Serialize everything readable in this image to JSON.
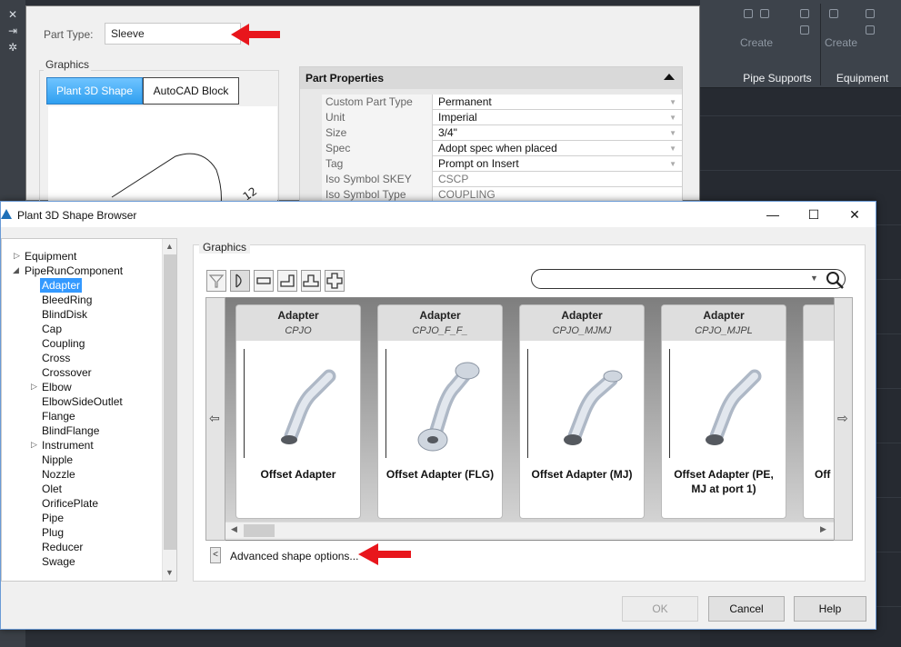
{
  "background": {
    "ribbon": {
      "panels": [
        {
          "label": "Pipe Supports",
          "create_label": "Create"
        },
        {
          "label": "Equipment",
          "create_label": "Create"
        }
      ]
    },
    "left_toolbar_glyphs": [
      "✕",
      "⇥",
      "✲"
    ]
  },
  "part_dialog": {
    "part_type_label": "Part Type:",
    "part_type_value": "Sleeve",
    "graphics_label": "Graphics",
    "tabs": [
      {
        "label": "Plant 3D Shape",
        "active": true
      },
      {
        "label": "AutoCAD Block",
        "active": false
      }
    ],
    "properties": {
      "header": "Part Properties",
      "rows": [
        {
          "name": "Custom Part Type",
          "value": "Permanent"
        },
        {
          "name": "Unit",
          "value": "Imperial"
        },
        {
          "name": "Size",
          "value": "3/4\""
        },
        {
          "name": "Spec",
          "value": "Adopt spec when placed"
        },
        {
          "name": "Tag",
          "value": "Prompt on Insert"
        },
        {
          "name": "Iso Symbol SKEY",
          "value": "CSCP"
        },
        {
          "name": "Iso Symbol Type",
          "value": "COUPLING"
        }
      ]
    }
  },
  "browser": {
    "title": "Plant 3D Shape Browser",
    "window_buttons": {
      "minimize": "—",
      "maximize": "☐",
      "close": "✕"
    },
    "tree": {
      "root_items": [
        {
          "label": "Equipment",
          "expander": "▷"
        },
        {
          "label": "PipeRunComponent",
          "expander": "◢"
        }
      ],
      "children": [
        {
          "label": "Adapter",
          "selected": true
        },
        {
          "label": "BleedRing"
        },
        {
          "label": "BlindDisk"
        },
        {
          "label": "Cap"
        },
        {
          "label": "Coupling"
        },
        {
          "label": "Cross"
        },
        {
          "label": "Crossover"
        },
        {
          "label": "Elbow",
          "expander": "▷"
        },
        {
          "label": "ElbowSideOutlet"
        },
        {
          "label": "Flange"
        },
        {
          "label": "BlindFlange"
        },
        {
          "label": "Instrument",
          "expander": "▷"
        },
        {
          "label": "Nipple"
        },
        {
          "label": "Nozzle"
        },
        {
          "label": "Olet"
        },
        {
          "label": "OrificePlate"
        },
        {
          "label": "Pipe"
        },
        {
          "label": "Plug"
        },
        {
          "label": "Reducer"
        },
        {
          "label": "Swage"
        }
      ]
    },
    "graphics_label": "Graphics",
    "toolbar_icons": [
      "filter-icon",
      "end-type-icon",
      "inline-icon",
      "elbow-shape-icon",
      "tee-shape-icon",
      "cross-shape-icon"
    ],
    "search": {
      "value": "",
      "placeholder": ""
    },
    "cards": [
      {
        "category": "Adapter",
        "code": "CPJO",
        "name": "Offset Adapter"
      },
      {
        "category": "Adapter",
        "code": "CPJO_F_F_",
        "name": "Offset Adapter (FLG)"
      },
      {
        "category": "Adapter",
        "code": "CPJO_MJMJ",
        "name": "Offset Adapter (MJ)"
      },
      {
        "category": "Adapter",
        "code": "CPJO_MJPL",
        "name": "Offset Adapter (PE, MJ at port 1)"
      },
      {
        "category": "",
        "code": "",
        "name": "Off"
      }
    ],
    "advanced_toggle": "<",
    "advanced_label": "Advanced shape options...",
    "buttons": {
      "ok": "OK",
      "cancel": "Cancel",
      "help": "Help"
    }
  },
  "colors": {
    "accent_blue": "#3399ff",
    "tab_active": "#2f9ff0",
    "arrow_red": "#e8161c"
  }
}
